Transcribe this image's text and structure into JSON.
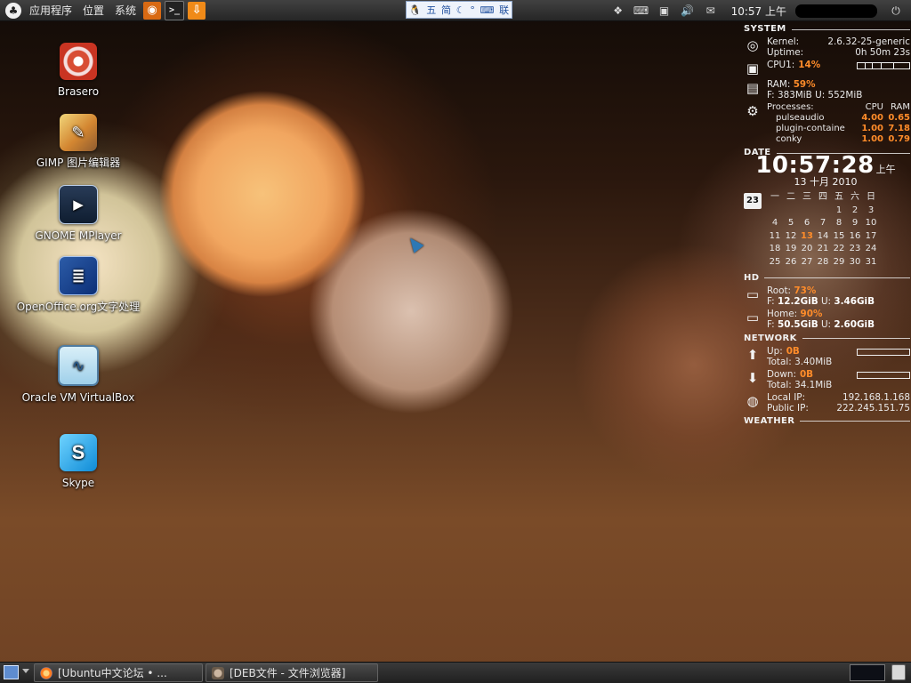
{
  "top_panel": {
    "menus": [
      "应用程序",
      "位置",
      "系统"
    ],
    "ime": {
      "items": [
        "五",
        "简",
        "联"
      ]
    },
    "clock": "10:57 上午"
  },
  "desktop": {
    "icons": [
      {
        "label": "Brasero",
        "icon": "brasero-icon"
      },
      {
        "label": "GIMP 图片编辑器",
        "icon": "gimp-icon"
      },
      {
        "label": "GNOME MPlayer",
        "icon": "mplayer-icon"
      },
      {
        "label": "OpenOffice.org文字处理",
        "icon": "openoffice-writer-icon"
      },
      {
        "label": "Oracle VM VirtualBox",
        "icon": "virtualbox-icon"
      },
      {
        "label": "Skype",
        "icon": "skype-icon"
      }
    ]
  },
  "conky": {
    "system": {
      "title": "SYSTEM",
      "kernel_label": "Kernel:",
      "kernel_value": "2.6.32-25-generic",
      "uptime_label": "Uptime:",
      "uptime_value": "0h 50m 23s",
      "cpu_label": "CPU1:",
      "cpu_value": "14%",
      "ram_label": "RAM:",
      "ram_value": "59%",
      "ram_detail_prefix": "F:",
      "ram_free": "383MiB",
      "ram_used_prefix": "U:",
      "ram_used": "552MiB",
      "processes_label": "Processes:",
      "proc_cpu_head": "CPU",
      "proc_ram_head": "RAM",
      "processes": [
        {
          "name": "pulseaudio",
          "cpu": "4.00",
          "ram": "0.65"
        },
        {
          "name": "plugin-containe",
          "cpu": "1.00",
          "ram": "7.18"
        },
        {
          "name": "conky",
          "cpu": "1.00",
          "ram": "0.79"
        }
      ]
    },
    "date": {
      "title": "DATE",
      "time": "10:57:28",
      "ampm": "上午",
      "date_line": "13 十月 2010",
      "weekdays": [
        "一",
        "二",
        "三",
        "四",
        "五",
        "六",
        "日"
      ],
      "calendar_rows": [
        [
          "",
          "",
          "",
          "",
          "1",
          "2",
          "3"
        ],
        [
          "4",
          "5",
          "6",
          "7",
          "8",
          "9",
          "10"
        ],
        [
          "11",
          "12",
          "13",
          "14",
          "15",
          "16",
          "17"
        ],
        [
          "18",
          "19",
          "20",
          "21",
          "22",
          "23",
          "24"
        ],
        [
          "25",
          "26",
          "27",
          "28",
          "29",
          "30",
          "31"
        ]
      ],
      "calendar_icon_day": "23"
    },
    "hd": {
      "title": "HD",
      "root_label": "Root:",
      "root_percent": "73%",
      "root_free_label": "F:",
      "root_free": "12.2GiB",
      "root_used_label": "U:",
      "root_used": "3.46GiB",
      "home_label": "Home:",
      "home_percent": "90%",
      "home_free_label": "F:",
      "home_free": "50.5GiB",
      "home_used_label": "U:",
      "home_used": "2.60GiB"
    },
    "network": {
      "title": "NETWORK",
      "up_label": "Up:",
      "up_rate": "0B",
      "up_total_label": "Total:",
      "up_total": "3.40MiB",
      "down_label": "Down:",
      "down_rate": "0B",
      "down_total_label": "Total:",
      "down_total": "34.1MiB",
      "local_ip_label": "Local IP:",
      "local_ip": "192.168.1.168",
      "public_ip_label": "Public IP:",
      "public_ip": "222.245.151.75"
    },
    "weather": {
      "title": "WEATHER"
    }
  },
  "bottom_panel": {
    "tasks": [
      {
        "label": "[Ubuntu中文论坛 • ..."
      },
      {
        "label": "[DEB文件 - 文件浏览器]"
      }
    ]
  }
}
